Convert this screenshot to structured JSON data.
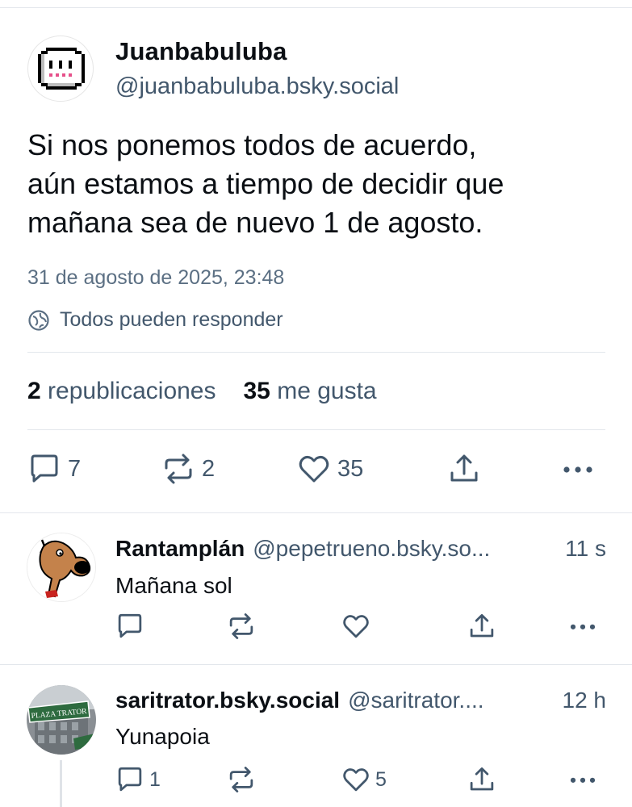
{
  "post": {
    "display_name": "Juanbabuluba",
    "handle": "@juanbabuluba.bsky.social",
    "text_lines": [
      "Si nos ponemos todos de acuerdo,",
      "aún estamos a tiempo de decidir que",
      "mañana sea de nuevo 1 de agosto."
    ],
    "timestamp": "31 de agosto de 2025, 23:48",
    "reply_setting": "Todos pueden responder",
    "stats": {
      "reposts_count": "2",
      "reposts_label": "republicaciones",
      "likes_count": "35",
      "likes_label": "me gusta"
    },
    "actions": {
      "reply_count": "7",
      "repost_count": "2",
      "like_count": "35"
    }
  },
  "replies": [
    {
      "display_name": "Rantamplán",
      "handle": "@pepetrueno.bsky.so...",
      "time": "11 s",
      "text": "Mañana sol",
      "reply_count": "",
      "repost_count": "",
      "like_count": ""
    },
    {
      "display_name": "saritrator.bsky.social",
      "handle": "@saritrator....",
      "time": "12 h",
      "text": "Yunapoia",
      "avatar_sign": "PLAZA TRATOR",
      "reply_count": "1",
      "repost_count": "",
      "like_count": "5"
    }
  ],
  "icons": [
    "ghost-avatar",
    "globe-icon",
    "reply-icon",
    "repost-icon",
    "like-icon",
    "share-icon",
    "more-icon"
  ],
  "colors": {
    "text": "#0b0f14",
    "muted": "#42576c",
    "divider": "#e3e7ec"
  }
}
